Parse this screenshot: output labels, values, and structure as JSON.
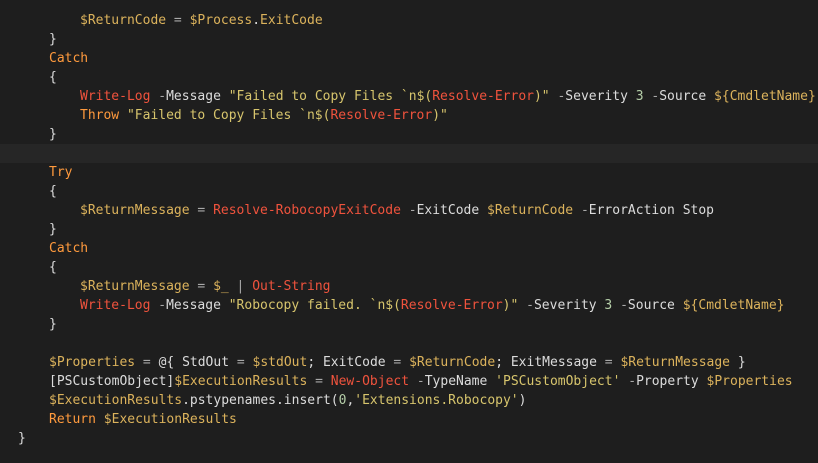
{
  "editor": {
    "colors": {
      "background": "#1e1e1e",
      "current_line": "#262626",
      "default": "#dcdcdc",
      "variable": "#dcb35c",
      "keyword": "#ff9a3d",
      "command": "#f0533d",
      "string": "#d7c56d",
      "number": "#b5cea8",
      "operator": "#a9a9a9",
      "parameter": "#dcdcdc"
    },
    "current_line_index": 7,
    "lines": [
      {
        "indent": 2,
        "tokens": [
          {
            "t": "$",
            "c": "variable"
          },
          {
            "t": "ReturnCode",
            "c": "variable"
          },
          {
            "t": " = ",
            "c": "operator"
          },
          {
            "t": "$",
            "c": "variable"
          },
          {
            "t": "Process",
            "c": "variable"
          },
          {
            "t": ".",
            "c": "default"
          },
          {
            "t": "ExitCode",
            "c": "variable"
          }
        ]
      },
      {
        "indent": 1,
        "tokens": [
          {
            "t": "}",
            "c": "default"
          }
        ]
      },
      {
        "indent": 1,
        "tokens": [
          {
            "t": "Catch",
            "c": "keyword"
          }
        ]
      },
      {
        "indent": 1,
        "tokens": [
          {
            "t": "{",
            "c": "default"
          }
        ]
      },
      {
        "indent": 2,
        "tokens": [
          {
            "t": "Write-Log",
            "c": "command"
          },
          {
            "t": " -",
            "c": "operator"
          },
          {
            "t": "Message",
            "c": "parameter"
          },
          {
            "t": " \"Failed to Copy Files `n$(",
            "c": "string"
          },
          {
            "t": "Resolve-Error",
            "c": "command"
          },
          {
            "t": ")\"",
            "c": "string"
          },
          {
            "t": " -",
            "c": "operator"
          },
          {
            "t": "Severity",
            "c": "parameter"
          },
          {
            "t": " 3",
            "c": "number"
          },
          {
            "t": " -",
            "c": "operator"
          },
          {
            "t": "Source",
            "c": "parameter"
          },
          {
            "t": " ${",
            "c": "variable"
          },
          {
            "t": "CmdletName",
            "c": "variable"
          },
          {
            "t": "}",
            "c": "variable"
          }
        ]
      },
      {
        "indent": 2,
        "tokens": [
          {
            "t": "Throw",
            "c": "keyword"
          },
          {
            "t": " \"Failed to Copy Files `n$(",
            "c": "string"
          },
          {
            "t": "Resolve-Error",
            "c": "command"
          },
          {
            "t": ")\"",
            "c": "string"
          }
        ]
      },
      {
        "indent": 1,
        "tokens": [
          {
            "t": "}",
            "c": "default"
          }
        ]
      },
      {
        "indent": 0,
        "tokens": []
      },
      {
        "indent": 1,
        "tokens": [
          {
            "t": "Try",
            "c": "keyword"
          }
        ]
      },
      {
        "indent": 1,
        "tokens": [
          {
            "t": "{",
            "c": "default"
          }
        ]
      },
      {
        "indent": 2,
        "tokens": [
          {
            "t": "$",
            "c": "variable"
          },
          {
            "t": "ReturnMessage",
            "c": "variable"
          },
          {
            "t": " = ",
            "c": "operator"
          },
          {
            "t": "Resolve-RobocopyExitCode",
            "c": "command"
          },
          {
            "t": " -",
            "c": "operator"
          },
          {
            "t": "ExitCode",
            "c": "parameter"
          },
          {
            "t": " $",
            "c": "variable"
          },
          {
            "t": "ReturnCode",
            "c": "variable"
          },
          {
            "t": " -",
            "c": "operator"
          },
          {
            "t": "ErrorAction",
            "c": "parameter"
          },
          {
            "t": " Stop",
            "c": "default"
          }
        ]
      },
      {
        "indent": 1,
        "tokens": [
          {
            "t": "}",
            "c": "default"
          }
        ]
      },
      {
        "indent": 1,
        "tokens": [
          {
            "t": "Catch",
            "c": "keyword"
          }
        ]
      },
      {
        "indent": 1,
        "tokens": [
          {
            "t": "{",
            "c": "default"
          }
        ]
      },
      {
        "indent": 2,
        "tokens": [
          {
            "t": "$",
            "c": "variable"
          },
          {
            "t": "ReturnMessage",
            "c": "variable"
          },
          {
            "t": " = ",
            "c": "operator"
          },
          {
            "t": "$_",
            "c": "variable"
          },
          {
            "t": " | ",
            "c": "operator"
          },
          {
            "t": "Out-String",
            "c": "command"
          }
        ]
      },
      {
        "indent": 2,
        "tokens": [
          {
            "t": "Write-Log",
            "c": "command"
          },
          {
            "t": " -",
            "c": "operator"
          },
          {
            "t": "Message",
            "c": "parameter"
          },
          {
            "t": " \"Robocopy failed. `n$(",
            "c": "string"
          },
          {
            "t": "Resolve-Error",
            "c": "command"
          },
          {
            "t": ")\"",
            "c": "string"
          },
          {
            "t": " -",
            "c": "operator"
          },
          {
            "t": "Severity",
            "c": "parameter"
          },
          {
            "t": " 3",
            "c": "number"
          },
          {
            "t": " -",
            "c": "operator"
          },
          {
            "t": "Source",
            "c": "parameter"
          },
          {
            "t": " ${",
            "c": "variable"
          },
          {
            "t": "CmdletName",
            "c": "variable"
          },
          {
            "t": "}",
            "c": "variable"
          }
        ]
      },
      {
        "indent": 1,
        "tokens": [
          {
            "t": "}",
            "c": "default"
          }
        ]
      },
      {
        "indent": 0,
        "tokens": []
      },
      {
        "indent": 1,
        "tokens": [
          {
            "t": "$",
            "c": "variable"
          },
          {
            "t": "Properties",
            "c": "variable"
          },
          {
            "t": " = ",
            "c": "operator"
          },
          {
            "t": "@{",
            "c": "default"
          },
          {
            "t": " StdOut",
            "c": "default"
          },
          {
            "t": " = ",
            "c": "operator"
          },
          {
            "t": "$",
            "c": "variable"
          },
          {
            "t": "stdOut",
            "c": "variable"
          },
          {
            "t": ";",
            "c": "default"
          },
          {
            "t": " ExitCode",
            "c": "default"
          },
          {
            "t": " = ",
            "c": "operator"
          },
          {
            "t": "$",
            "c": "variable"
          },
          {
            "t": "ReturnCode",
            "c": "variable"
          },
          {
            "t": ";",
            "c": "default"
          },
          {
            "t": " ExitMessage",
            "c": "default"
          },
          {
            "t": " = ",
            "c": "operator"
          },
          {
            "t": "$",
            "c": "variable"
          },
          {
            "t": "ReturnMessage",
            "c": "variable"
          },
          {
            "t": " }",
            "c": "default"
          }
        ]
      },
      {
        "indent": 1,
        "tokens": [
          {
            "t": "[PSCustomObject]",
            "c": "default"
          },
          {
            "t": "$",
            "c": "variable"
          },
          {
            "t": "ExecutionResults",
            "c": "variable"
          },
          {
            "t": " = ",
            "c": "operator"
          },
          {
            "t": "New-Object",
            "c": "command"
          },
          {
            "t": " -",
            "c": "operator"
          },
          {
            "t": "TypeName",
            "c": "parameter"
          },
          {
            "t": " 'PSCustomObject'",
            "c": "string"
          },
          {
            "t": " -",
            "c": "operator"
          },
          {
            "t": "Property",
            "c": "parameter"
          },
          {
            "t": " $",
            "c": "variable"
          },
          {
            "t": "Properties",
            "c": "variable"
          }
        ]
      },
      {
        "indent": 1,
        "tokens": [
          {
            "t": "$",
            "c": "variable"
          },
          {
            "t": "ExecutionResults",
            "c": "variable"
          },
          {
            "t": ".pstypenames.insert(",
            "c": "default"
          },
          {
            "t": "0",
            "c": "number"
          },
          {
            "t": ",",
            "c": "default"
          },
          {
            "t": "'Extensions.Robocopy'",
            "c": "string"
          },
          {
            "t": ")",
            "c": "default"
          }
        ]
      },
      {
        "indent": 1,
        "tokens": [
          {
            "t": "Return",
            "c": "keyword"
          },
          {
            "t": " $",
            "c": "variable"
          },
          {
            "t": "ExecutionResults",
            "c": "variable"
          }
        ]
      },
      {
        "indent": 0,
        "tokens": [
          {
            "t": "}",
            "c": "default"
          }
        ]
      }
    ]
  }
}
